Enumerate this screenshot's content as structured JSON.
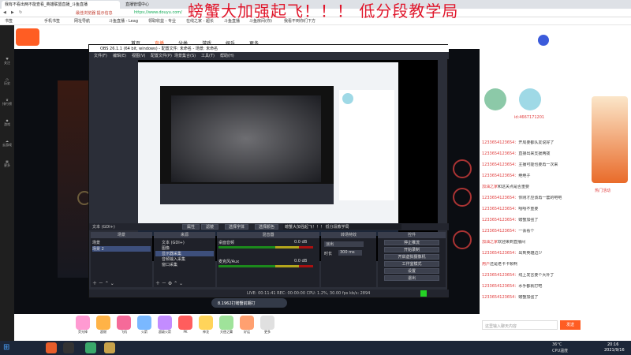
{
  "overlay_text": "螃蟹大加强起飞！！！ 低分段教学局",
  "browser": {
    "tab_title": "我有不看出两不能查看_英雄联盟直播_斗鱼直播",
    "tab2_title": "直播管理中心",
    "url": "https://www.douyu.com/",
    "url_prefix": "最佳浏览器 提示信息",
    "bookmarks": [
      "书签",
      "手机书签",
      "网址导航",
      "斗鱼直播 - Leag",
      "领取收益 - 专业",
      "在线之家 - 超长",
      "斗鱼直播",
      "斗鱼房间(你)",
      "我看不到你们下方"
    ]
  },
  "nav": {
    "items": [
      "首页",
      "直播",
      "分类",
      "游戏",
      "娱乐",
      "更多"
    ]
  },
  "sidebar": [
    "关注",
    "历史",
    "排行榜",
    "游戏",
    "云游戏",
    "更多"
  ],
  "obs": {
    "title": "OBS 26.1.1 (64 bit, windows) - 配置文件: 未命名 - 场景: 未命名",
    "menu": [
      "文件(F)",
      "编辑(E)",
      "视图(V)",
      "配置文件(P)",
      "场景集合(S)",
      "工具(T)",
      "帮助(H)"
    ],
    "source_bar": {
      "label": "文本 (GDI+)",
      "props": "属性",
      "filter": "滤镜",
      "select_font": "选择字体",
      "select_color": "选择颜色",
      "text": "螃蟹大加强起飞！！！ 低分段教学局"
    },
    "panels": {
      "scenes": "场景",
      "sources": "来源",
      "mixer": "混音器",
      "transitions": "转场特效",
      "controls": "控件"
    },
    "scenes": [
      "场景",
      "场景 2"
    ],
    "sources": [
      "文本 (GDI+)",
      "图像",
      "显示器采集",
      "音频输入采集",
      "窗口采集"
    ],
    "mixer": [
      {
        "name": "桌面音频",
        "level": "0.0 dB"
      },
      {
        "name": "麦克风/Aux",
        "level": "0.0 dB"
      }
    ],
    "transition": {
      "type": "淡出",
      "duration_label": "时长",
      "duration": "300 ms"
    },
    "controls": [
      "停止推流",
      "开始录制",
      "开启虚拟摄像机",
      "工作室模式",
      "设置",
      "退出"
    ],
    "status": "LIVE: 00:11:41  REC: 00:00:00  CPU: 1.2%, 30.00 fps  kb/s: 2894"
  },
  "chat": [
    {
      "u": "1233654123654：",
      "t": "开局要都队友说好了"
    },
    {
      "u": "1233654123654：",
      "t": "直接出来支援两拨"
    },
    {
      "u": "1233654123654：",
      "t": "主播可能也要再一次来"
    },
    {
      "u": "1233654123654：",
      "t": "绝绝子"
    },
    {
      "u": "加油之家",
      "t": "和这关点是否重要"
    },
    {
      "u": "1233654123654：",
      "t": "你刚才应该再一套的吧吧"
    },
    {
      "u": "1233654123654：",
      "t": "嘻嘻不重要"
    },
    {
      "u": "1233654123654：",
      "t": "螃蟹加强了"
    },
    {
      "u": "1233654123654：",
      "t": "一会看个"
    },
    {
      "u": "加油之家",
      "t": "欢迎来到直播间"
    },
    {
      "u": "1233654123654：",
      "t": "出到英雄边少"
    },
    {
      "u": "用户",
      "t": "还是老卡卡顿啊"
    },
    {
      "u": "1233654123654：",
      "t": "线上发言要个大补丁"
    },
    {
      "u": "1233654123654：",
      "t": "水手都就打吧"
    },
    {
      "u": "1233654123654：",
      "t": "螃蟹加强了"
    }
  ],
  "chat_input_placeholder": "这里输入聊天内容",
  "chat_send": "发送",
  "user_id": "id:4667171201",
  "stream_caption": "8.1962打螃蟹前期打",
  "gifts": [
    "荧光棒",
    "超燃",
    "飞机",
    "火箭",
    "超级火箭",
    "PK",
    "神龙",
    "天使之翼",
    "好运",
    "更多"
  ],
  "taskbar": {
    "time": "20:16",
    "date": "2021/9/16",
    "temp": "36°C",
    "cpu": "CPU温度"
  },
  "ad_label": "热门活动",
  "colors": {
    "accent": "#ff5d23",
    "red": "#e0162b",
    "obs_bg": "#2b2e38"
  }
}
